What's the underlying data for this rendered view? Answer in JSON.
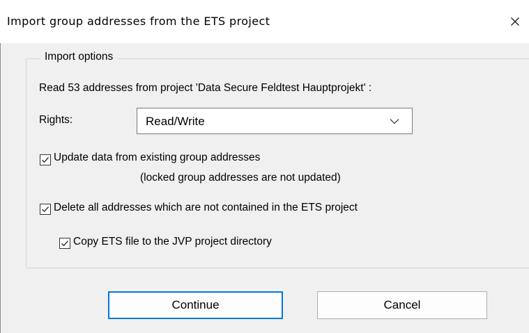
{
  "dialog": {
    "title": "Import group addresses from the ETS project",
    "close_glyph": "×"
  },
  "import_options": {
    "legend": "Import options",
    "read_text": "Read 53 addresses from project 'Data Secure Feldtest Hauptprojekt' :",
    "rights_label": "Rights:",
    "rights_value": "Read/Write",
    "update_label": "Update data from existing group addresses",
    "update_note": "(locked group addresses are not updated)",
    "update_checked": true,
    "delete_label": "Delete all addresses which are not contained in the ETS project",
    "delete_checked": true,
    "copy_label": "Copy ETS file to the JVP project directory",
    "copy_checked": true
  },
  "buttons": {
    "continue_label": "Continue",
    "cancel_label": "Cancel"
  },
  "icons": {
    "close": "close-icon",
    "dropdown": "chevron-down-icon",
    "checkmark": "checkmark-icon"
  },
  "colors": {
    "dialog_bg": "#f0f0f0",
    "titlebar_bg": "#ffffff",
    "default_button_border": "#0078d7"
  }
}
